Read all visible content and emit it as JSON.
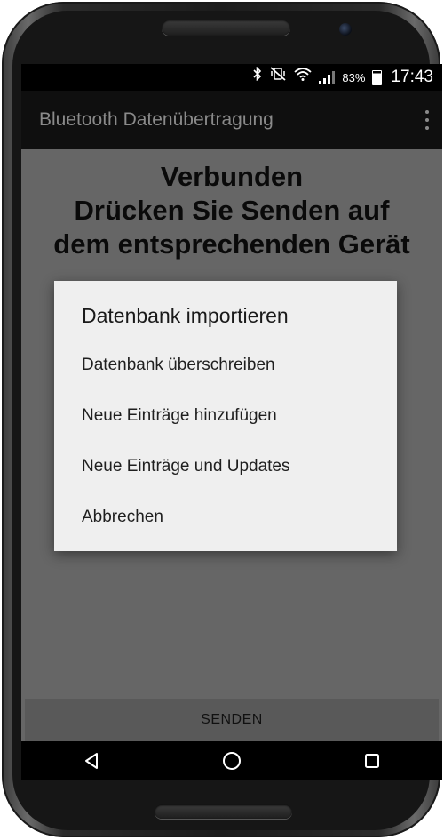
{
  "status_bar": {
    "battery_percent": "83%",
    "time": "17:43",
    "icons": [
      "bluetooth-icon",
      "vibrate-mute-icon",
      "wifi-icon",
      "signal-icon",
      "battery-charging-icon"
    ]
  },
  "app_bar": {
    "title": "Bluetooth Datenübertragung",
    "overflow_icon": "more-vert-icon"
  },
  "main": {
    "status_lines": [
      "Verbunden",
      "Drücken Sie Senden auf",
      "dem entsprechenden Gerät"
    ]
  },
  "dialog": {
    "title": "Datenbank importieren",
    "options": [
      "Datenbank überschreiben",
      "Neue Einträge hinzufügen",
      "Neue Einträge und Updates",
      "Abbrechen"
    ]
  },
  "send_button_label": "SENDEN",
  "nav": {
    "back_icon": "back-triangle-icon",
    "home_icon": "home-circle-icon",
    "recents_icon": "recents-square-icon"
  }
}
